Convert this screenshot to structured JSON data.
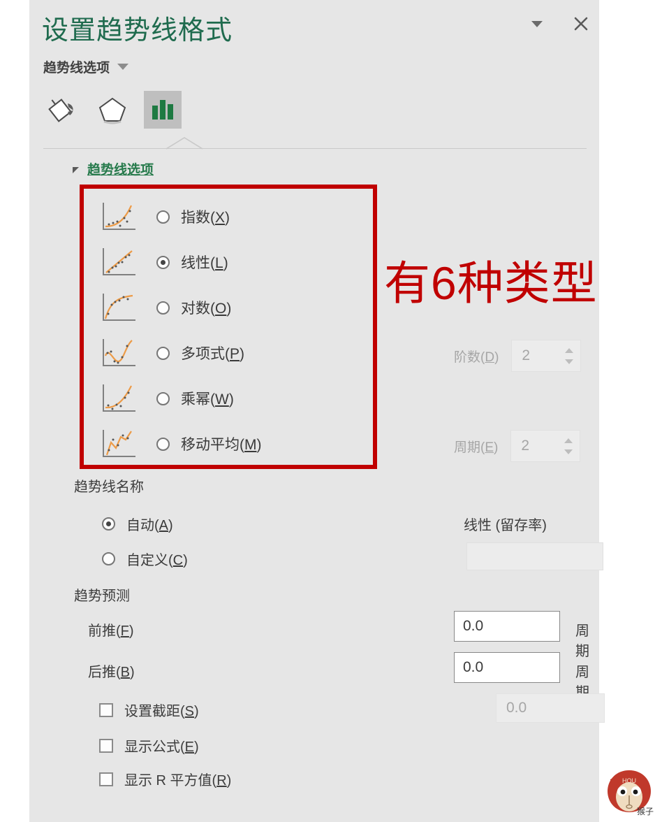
{
  "pane": {
    "title": "设置趋势线格式",
    "subtitle": "趋势线选项",
    "collapse_icon": "chevron-down-icon",
    "close_icon": "close-icon",
    "accent_title_color": "#1f6b4e",
    "background_color": "#e6e6e6"
  },
  "tabs": [
    {
      "name": "fill-and-line",
      "icon": "paint-bucket-icon",
      "selected": false
    },
    {
      "name": "effects",
      "icon": "pentagon-effects-icon",
      "selected": false
    },
    {
      "name": "trendline-options",
      "icon": "bar-chart-icon",
      "selected": true
    }
  ],
  "section": {
    "heading": "趋势线选项",
    "heading_color": "#267a4b",
    "expand_icon": "triangle-collapse-icon"
  },
  "annotation": {
    "text": "有6种类型",
    "color": "#c00000",
    "box_color": "#c00000"
  },
  "trendline_types": [
    {
      "label": "指数",
      "accel": "X",
      "selected": false,
      "thumb": "exponential-curve-thumb"
    },
    {
      "label": "线性",
      "accel": "L",
      "selected": true,
      "thumb": "linear-line-thumb"
    },
    {
      "label": "对数",
      "accel": "O",
      "selected": false,
      "thumb": "logarithmic-curve-thumb"
    },
    {
      "label": "多项式",
      "accel": "P",
      "selected": false,
      "thumb": "polynomial-curve-thumb"
    },
    {
      "label": "乘幂",
      "accel": "W",
      "selected": false,
      "thumb": "power-curve-thumb"
    },
    {
      "label": "移动平均",
      "accel": "M",
      "selected": false,
      "thumb": "moving-average-thumb"
    }
  ],
  "spinners": {
    "order": {
      "label": "阶数",
      "accel": "D",
      "value": "2",
      "enabled": false
    },
    "period": {
      "label": "周期",
      "accel": "E",
      "value": "2",
      "enabled": false
    }
  },
  "trendline_name": {
    "group_label": "趋势线名称",
    "auto": {
      "label": "自动",
      "accel": "A",
      "selected": true
    },
    "custom": {
      "label": "自定义",
      "accel": "C",
      "selected": false
    },
    "auto_value": "线性 (留存率)",
    "custom_value": ""
  },
  "forecast": {
    "group_label": "趋势预测",
    "forward": {
      "label": "前推",
      "accel": "F",
      "value": "0.0",
      "unit": "周期"
    },
    "backward": {
      "label": "后推",
      "accel": "B",
      "value": "0.0",
      "unit": "周期"
    }
  },
  "checkboxes": [
    {
      "label": "设置截距",
      "accel": "S",
      "checked": false
    },
    {
      "label": "显示公式",
      "accel": "E",
      "checked": false
    },
    {
      "label": "显示 R 平方值",
      "accel": "R",
      "checked": false
    }
  ],
  "intercept_value": "0.0",
  "watermark": {
    "top_text": "HOU",
    "caption": "猴子"
  }
}
